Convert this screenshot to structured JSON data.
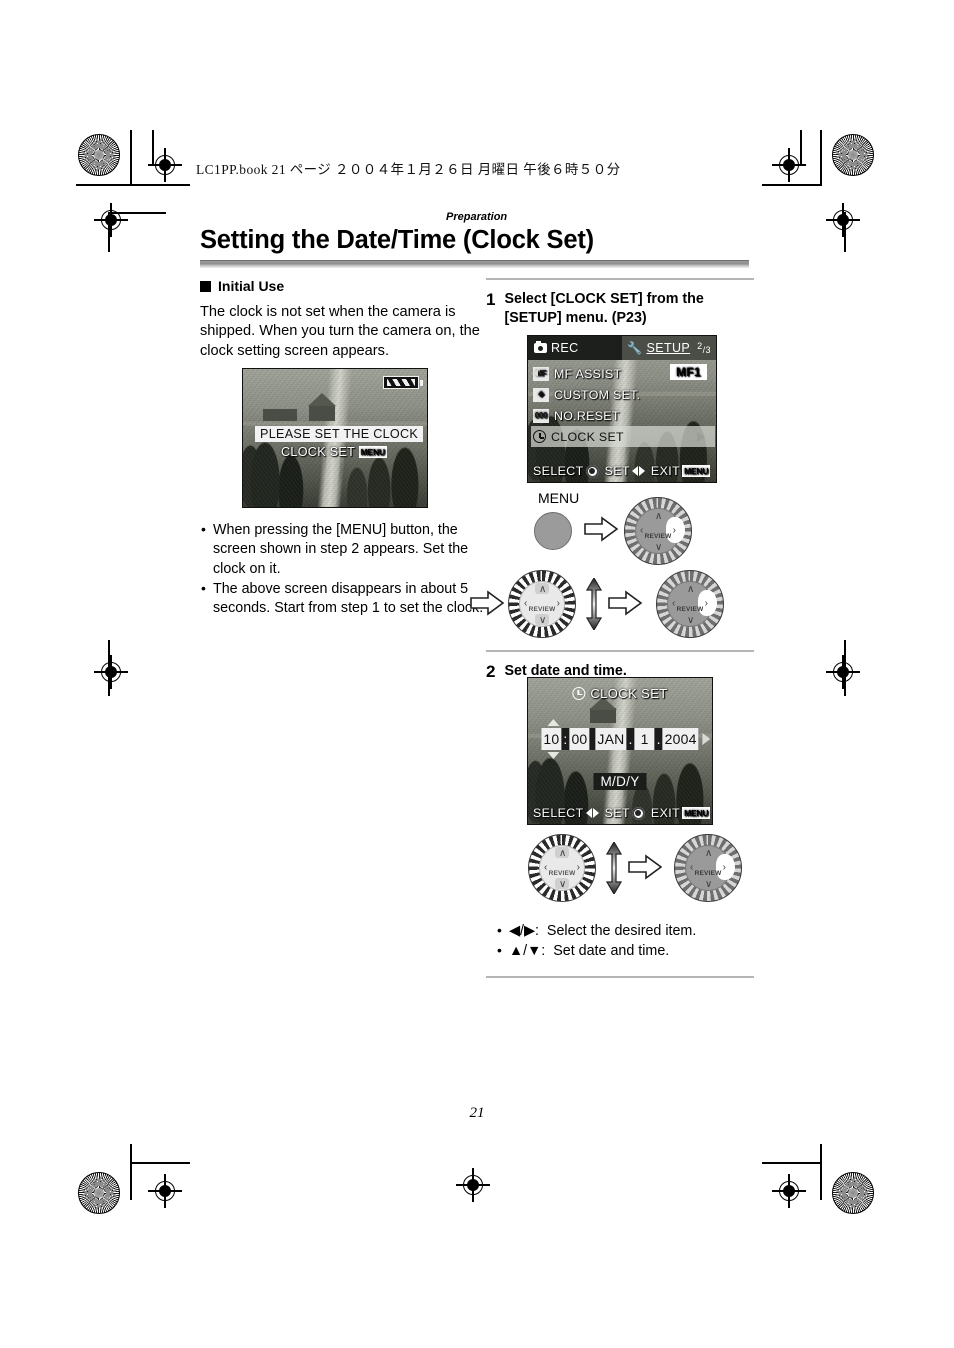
{
  "header": {
    "book_line": "LC1PP.book    21 ページ    ２００４年１月２６日    月曜日    午後６時５０分"
  },
  "section_label": "Preparation",
  "page_title": "Setting the Date/Time (Clock Set)",
  "page_number": "21",
  "left_column": {
    "sub_head": "Initial Use",
    "body": "The clock is not set when the camera is shipped. When you turn the camera on, the clock setting screen appears.",
    "lcd_initial": {
      "message": "PLEASE SET THE CLOCK",
      "clock_set_label": "CLOCK SET",
      "menu_badge": "MENU",
      "battery_icon": "battery-icon"
    },
    "bullets": [
      "When pressing the [MENU] button, the screen shown in step 2 appears. Set the clock on it.",
      "The above screen disappears in about 5 seconds. Start from step 1 to set the clock."
    ]
  },
  "right_column": {
    "step1": {
      "number": "1",
      "text": "Select [CLOCK SET] from the [SETUP] menu. (P23)",
      "menu_screen": {
        "tab_rec": "REC",
        "tab_setup": "SETUP",
        "page_indicator_num": "2",
        "page_indicator_den": "3",
        "items": [
          {
            "icon": "MF",
            "label": "MF ASSIST",
            "value": "MF1",
            "selected": false
          },
          {
            "icon": "custom-set-icon",
            "label": "CUSTOM SET.",
            "value": "",
            "selected": false
          },
          {
            "icon": "000",
            "label": "NO.RESET",
            "value": "",
            "selected": false
          },
          {
            "icon": "clock-icon",
            "label": "CLOCK SET",
            "value": "",
            "selected": true
          }
        ],
        "footer": {
          "select": "SELECT",
          "set": "SET",
          "exit": "EXIT",
          "menu_badge": "MENU"
        }
      },
      "diagram": {
        "menu_label": "MENU",
        "dial_center_label": "REVIEW"
      }
    },
    "step2": {
      "number": "2",
      "text": "Set date and time.",
      "clock_screen": {
        "title": "CLOCK SET",
        "hour": "10",
        "sep": ":",
        "minute": "00",
        "month": "JAN",
        "month_dot": ".",
        "day": "1",
        "day_dot": ".",
        "year": "2004",
        "format": "M/D/Y",
        "footer": {
          "select": "SELECT",
          "set": "SET",
          "exit": "EXIT",
          "menu_badge": "MENU"
        }
      },
      "diagram": {
        "dial_center_label": "REVIEW"
      },
      "bullets": [
        {
          "keys": "◀/▶",
          "sep": ":",
          "text": "Select the desired item."
        },
        {
          "keys": "▲/▼",
          "sep": ":",
          "text": "Set date and time."
        }
      ]
    }
  }
}
